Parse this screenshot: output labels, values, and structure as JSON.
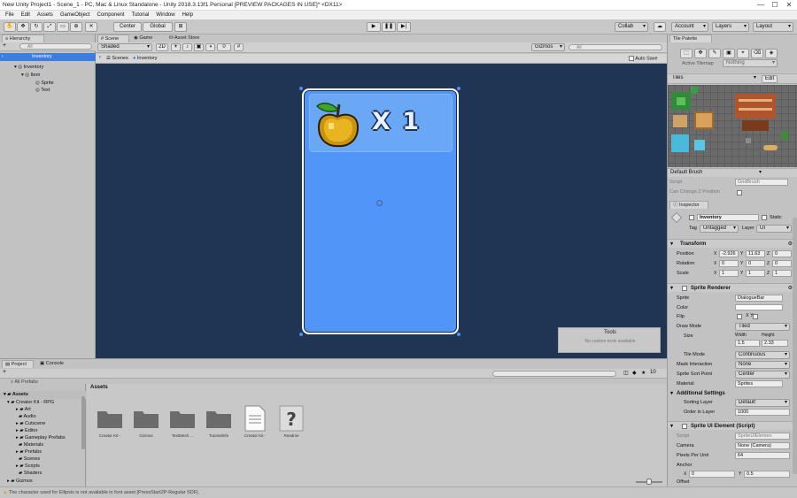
{
  "window": {
    "title": "New Unity Project1 - Scene_1 - PC, Mac & Linux Standalone - Unity 2018.3.13f1 Personal [PREVIEW PACKAGES IN USE]* <DX11>",
    "minimize": "—",
    "maximize": "☐",
    "close": "✕"
  },
  "menu": [
    "File",
    "Edit",
    "Assets",
    "GameObject",
    "Component",
    "Tutorial",
    "Window",
    "Help"
  ],
  "toolbar": {
    "center": "Center",
    "global": "Global",
    "play": "▶",
    "pause": "❚❚",
    "step": "▶|",
    "collab": "Collab",
    "cloud": "☁",
    "account": "Account",
    "layers": "Layers",
    "layout": "Layout"
  },
  "hierarchy": {
    "tab": "Hierarchy",
    "create": "+",
    "search": "All",
    "scene": "Inventory",
    "items": [
      {
        "label": "Inventory"
      },
      {
        "label": "Item"
      },
      {
        "label": "Sprite"
      },
      {
        "label": "Text"
      }
    ]
  },
  "scene_tabs": [
    {
      "label": "Scene"
    },
    {
      "label": "Game"
    },
    {
      "label": "Asset Store"
    }
  ],
  "scene_toolbar": {
    "shading": "Shaded",
    "mode2d": "2D",
    "gizmos": "Gizmos",
    "search": "All",
    "fx_count": "0"
  },
  "breadcrumb": {
    "scenes": "Scenes",
    "prefab": "Inventory",
    "auto_save": "Auto Save"
  },
  "card": {
    "count": "X 1"
  },
  "tools_overlay": {
    "title": "Tools",
    "text": "No custom tools available"
  },
  "tile_palette": {
    "tab": "Tile Palette",
    "active_tilemap_label": "Active Tilemap",
    "active_tilemap_value": "Nothing",
    "palette": "Tiles",
    "edit": "Edit",
    "brush": "Default Brush",
    "script_label": "Script",
    "script_value": "GridBrush",
    "z_label": "Can Change Z Position"
  },
  "inspector": {
    "tab": "Inspector",
    "name": "Inventory",
    "static": "Static",
    "tag_label": "Tag",
    "tag": "Untagged",
    "layer_label": "Layer",
    "layer": "UI",
    "transform": {
      "title": "Transform",
      "position_label": "Position",
      "position": {
        "x": "-2.926",
        "y": "11.63",
        "z": "0"
      },
      "rotation_label": "Rotation",
      "rotation": {
        "x": "0",
        "y": "0",
        "z": "0"
      },
      "scale_label": "Scale",
      "scale": {
        "x": "1",
        "y": "1",
        "z": "1"
      }
    },
    "sprite_renderer": {
      "title": "Sprite Renderer",
      "fields": [
        {
          "label": "Sprite",
          "value": "DialogueBar"
        },
        {
          "label": "Color",
          "value": ""
        },
        {
          "label": "Flip",
          "value": "X   Y"
        },
        {
          "label": "Draw Mode",
          "value": "Tiled"
        },
        {
          "label": "Size",
          "value": ""
        },
        {
          "label": "Tile Mode",
          "value": "Continuous"
        },
        {
          "label": "Mask Interaction",
          "value": "None"
        },
        {
          "label": "Sprite Sort Point",
          "value": "Center"
        },
        {
          "label": "Material",
          "value": "Sprites"
        }
      ],
      "size_width_label": "Width",
      "size_height_label": "Height",
      "size_width": "1.5",
      "size_height": "2.33"
    },
    "additional": {
      "title": "Additional Settings",
      "fields": [
        {
          "label": "Sorting Layer",
          "value": "Default"
        },
        {
          "label": "Order in Layer",
          "value": "1000"
        }
      ]
    },
    "ui_element": {
      "title": "Sprite UI Element (Script)",
      "fields": [
        {
          "label": "Script",
          "value": "SpriteUIElemen"
        },
        {
          "label": "Camera",
          "value": "None (Camera)"
        },
        {
          "label": "Pixels Per Unit",
          "value": "64"
        },
        {
          "label": "Anchor",
          "value": ""
        }
      ],
      "anchor_x": "0",
      "anchor_y": "0.5",
      "offset_label": "Offset"
    }
  },
  "project": {
    "tabs": [
      {
        "label": "Project"
      },
      {
        "label": "Console"
      }
    ],
    "create": "+",
    "favorites": "All Prefabs",
    "assets_header": "Assets",
    "tree": [
      {
        "label": "Assets"
      },
      {
        "label": "Creator Kit - RPG"
      },
      {
        "label": "Art"
      },
      {
        "label": "Audio"
      },
      {
        "label": "Cutscene"
      },
      {
        "label": "Editor"
      },
      {
        "label": "Gameplay Prefabs"
      },
      {
        "label": "Materials"
      },
      {
        "label": "Prefabs"
      },
      {
        "label": "Scenes"
      },
      {
        "label": "Scripts"
      },
      {
        "label": "Shaders"
      },
      {
        "label": "Gizmos"
      }
    ],
    "items": [
      {
        "label": "Creator Kit -"
      },
      {
        "label": "Gizmos"
      },
      {
        "label": "TextMesh ..."
      },
      {
        "label": "TutorialInfo"
      },
      {
        "label": "Creator Kit -"
      },
      {
        "label": "Readme"
      }
    ],
    "count": "10"
  },
  "status": {
    "text": "The character used for Ellipsis is not available in font asset [PressStart2P-Regular SDF]."
  }
}
